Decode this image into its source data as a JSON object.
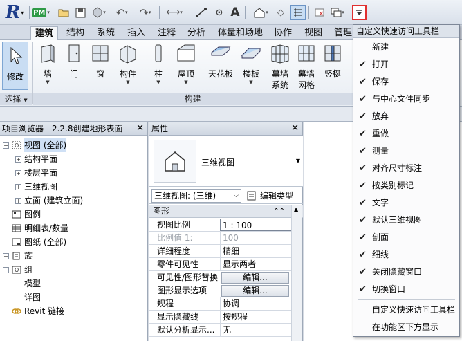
{
  "qat": {
    "app_logo": "R",
    "pm_label": "PM",
    "text_icon": "A"
  },
  "ribbon": {
    "tabs": [
      {
        "label": "建筑",
        "active": true
      },
      {
        "label": "结构"
      },
      {
        "label": "系统"
      },
      {
        "label": "插入"
      },
      {
        "label": "注释"
      },
      {
        "label": "分析"
      },
      {
        "label": "体量和场地"
      },
      {
        "label": "协作"
      },
      {
        "label": "视图"
      },
      {
        "label": "管理"
      }
    ],
    "modify_label": "修改",
    "buttons": [
      {
        "label": "墙",
        "has_arrow": true
      },
      {
        "label": "门"
      },
      {
        "label": "窗"
      },
      {
        "label": "构件",
        "has_arrow": true
      },
      {
        "label": "柱",
        "has_arrow": true
      },
      {
        "label": "屋顶",
        "has_arrow": true
      },
      {
        "label": "天花板"
      },
      {
        "label": "楼板",
        "has_arrow": true
      },
      {
        "label": "幕墙",
        "label2": "系统"
      },
      {
        "label": "幕墙",
        "label2": "网格"
      },
      {
        "label": "竖梃"
      }
    ],
    "panel_select_label": "选择",
    "panel_build_label": "构建"
  },
  "project_browser": {
    "title": "项目浏览器 - 2.2.8创建地形表面",
    "items": [
      {
        "label": "视图 (全部)",
        "level": 0,
        "exp": "−",
        "icon": "views-icon",
        "selected": true
      },
      {
        "label": "结构平面",
        "level": 1,
        "exp": "+"
      },
      {
        "label": "楼层平面",
        "level": 1,
        "exp": "+"
      },
      {
        "label": "三维视图",
        "level": 1,
        "exp": "+"
      },
      {
        "label": "立面 (建筑立面)",
        "level": 1,
        "exp": "+"
      },
      {
        "label": "图例",
        "level": 0,
        "exp": "",
        "icon": "legend-icon"
      },
      {
        "label": "明细表/数量",
        "level": 0,
        "exp": "",
        "icon": "schedule-icon"
      },
      {
        "label": "图纸 (全部)",
        "level": 0,
        "exp": "",
        "icon": "sheet-icon"
      },
      {
        "label": "族",
        "level": 0,
        "exp": "+",
        "icon": "family-icon"
      },
      {
        "label": "组",
        "level": 0,
        "exp": "−",
        "icon": "group-icon"
      },
      {
        "label": "模型",
        "level": 1,
        "exp": ""
      },
      {
        "label": "详图",
        "level": 1,
        "exp": ""
      },
      {
        "label": "Revit 链接",
        "level": 0,
        "exp": "",
        "icon": "link-icon"
      }
    ]
  },
  "properties": {
    "title": "属性",
    "type_name": "三维视图",
    "instance_select": "三维视图: (三维)",
    "edit_type_label": "编辑类型",
    "group_label": "图形",
    "rows": [
      {
        "name": "视图比例",
        "value": "1 : 100",
        "style": "boxed"
      },
      {
        "name": "比例值 1:",
        "value": "100",
        "disabled": true
      },
      {
        "name": "详细程度",
        "value": "精细"
      },
      {
        "name": "零件可见性",
        "value": "显示两者"
      },
      {
        "name": "可见性/图形替换",
        "value": "编辑...",
        "style": "btn"
      },
      {
        "name": "图形显示选项",
        "value": "编辑...",
        "style": "btn"
      },
      {
        "name": "规程",
        "value": "协调"
      },
      {
        "name": "显示隐藏线",
        "value": "按规程"
      },
      {
        "name": "默认分析显示...",
        "value": "无"
      }
    ]
  },
  "qat_menu": {
    "header": "自定义快速访问工具栏",
    "items": [
      {
        "label": "新建",
        "checked": false
      },
      {
        "label": "打开",
        "checked": true
      },
      {
        "label": "保存",
        "checked": true
      },
      {
        "label": "与中心文件同步",
        "checked": true
      },
      {
        "label": "放弃",
        "checked": true
      },
      {
        "label": "重做",
        "checked": true
      },
      {
        "label": "测量",
        "checked": true
      },
      {
        "label": "对齐尺寸标注",
        "checked": true
      },
      {
        "label": "按类别标记",
        "checked": true
      },
      {
        "label": "文字",
        "checked": true
      },
      {
        "label": "默认三维视图",
        "checked": true
      },
      {
        "label": "剖面",
        "checked": true
      },
      {
        "label": "细线",
        "checked": true
      },
      {
        "label": "关闭隐藏窗口",
        "checked": true
      },
      {
        "label": "切换窗口",
        "checked": true
      }
    ],
    "footer_items": [
      {
        "label": "自定义快速访问工具栏"
      },
      {
        "label": "在功能区下方显示"
      }
    ]
  },
  "colors": {
    "highlight_border": "#e03030",
    "accent": "#1d3d8a"
  }
}
